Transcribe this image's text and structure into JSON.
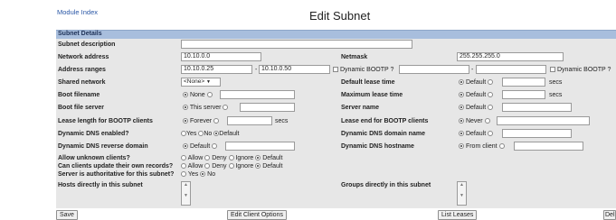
{
  "header": {
    "module_index": "Module Index",
    "title": "Edit Subnet"
  },
  "section": {
    "title": "Subnet Details"
  },
  "fields": {
    "subnet_description": {
      "label": "Subnet description",
      "value": ""
    },
    "network_address": {
      "label": "Network address",
      "value": "10.10.0.0"
    },
    "netmask": {
      "label": "Netmask",
      "value": "255.255.255.0"
    },
    "address_ranges": {
      "label": "Address ranges",
      "start": "10.10.0.25",
      "dash": "-",
      "end": "10.10.0.50",
      "dyn_bootp": "Dynamic BOOTP ?",
      "start2": "",
      "dash2": "-",
      "end2": "",
      "dyn_bootp2": "Dynamic BOOTP ?"
    },
    "shared_network": {
      "label": "Shared network",
      "selected": "<None>"
    },
    "default_lease_time": {
      "label": "Default lease time",
      "opt": "Default",
      "unit": "secs"
    },
    "boot_filename": {
      "label": "Boot filename",
      "opt": "None"
    },
    "max_lease_time": {
      "label": "Maximum lease time",
      "opt": "Default",
      "unit": "secs"
    },
    "boot_file_server": {
      "label": "Boot file server",
      "opt": "This server"
    },
    "server_name": {
      "label": "Server name",
      "opt": "Default"
    },
    "lease_length_bootp": {
      "label": "Lease length for BOOTP clients",
      "opt": "Forever",
      "unit": "secs"
    },
    "lease_end_bootp": {
      "label": "Lease end for BOOTP clients",
      "opt": "Never"
    },
    "dynamic_dns_enabled": {
      "label": "Dynamic DNS enabled?",
      "yes": "Yes",
      "no": "No",
      "default": "Default"
    },
    "dynamic_dns_domain": {
      "label": "Dynamic DNS domain name",
      "opt": "Default"
    },
    "dynamic_dns_reverse": {
      "label": "Dynamic DNS reverse domain",
      "opt": "Default"
    },
    "dynamic_dns_hostname": {
      "label": "Dynamic DNS hostname",
      "opt": "From client"
    },
    "allow_unknown": {
      "label": "Allow unknown clients?",
      "allow": "Allow",
      "deny": "Deny",
      "ignore": "Ignore",
      "default": "Default"
    },
    "clients_update_records": {
      "label": "Can clients update their own records?",
      "allow": "Allow",
      "deny": "Deny",
      "ignore": "Ignore",
      "default": "Default"
    },
    "server_authoritative": {
      "label": "Server is authoritative for this subnet?",
      "yes": "Yes",
      "no": "No"
    },
    "hosts_in_subnet": {
      "label": "Hosts directly in this subnet"
    },
    "groups_in_subnet": {
      "label": "Groups directly in this subnet"
    }
  },
  "buttons": {
    "save": "Save",
    "edit_client_options": "Edit Client Options",
    "list_leases": "List Leases",
    "delete": "Del"
  }
}
